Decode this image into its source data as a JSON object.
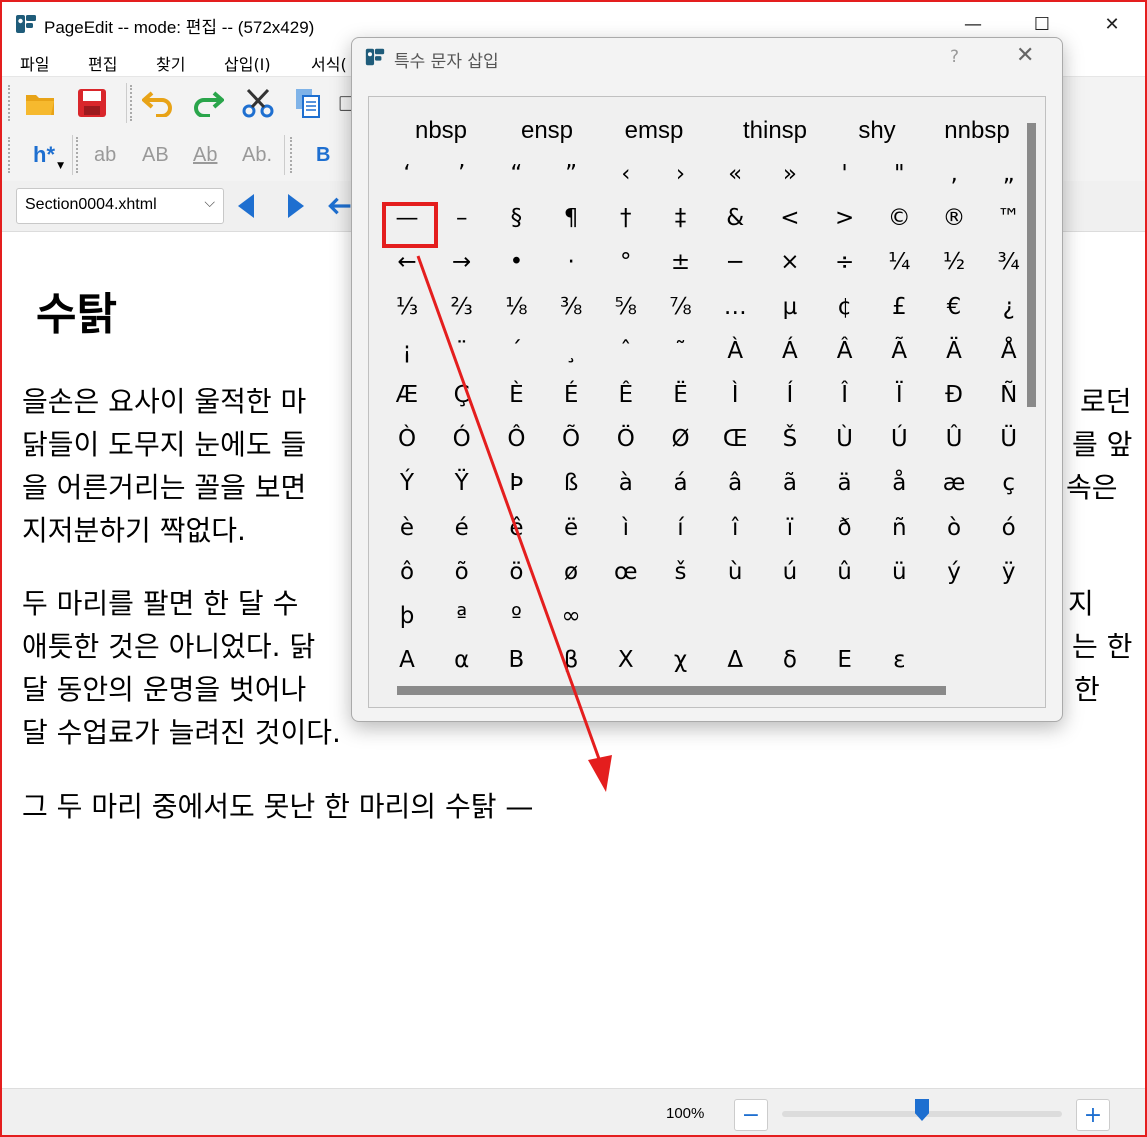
{
  "window": {
    "title": "PageEdit -- mode: 편집 -- (572x429)",
    "minimize": "—",
    "maximize": "☐",
    "close": "✕"
  },
  "menu": [
    "파일",
    "편집",
    "찾기",
    "삽입(I)",
    "서식("
  ],
  "toolbar": {
    "heading_button": "h*",
    "format_buttons": [
      "ab",
      "AB",
      "Ab",
      "Ab."
    ],
    "bold": "B",
    "file_select": "Section0004.xhtml"
  },
  "document": {
    "heading": "수탉",
    "paragraphs": [
      [
        "을손은 요사이 울적한 마",
        "로던",
        "닭들이 도무지 눈에도 들",
        "를 앞",
        "을 어른거리는 꼴을 보면",
        "속은",
        "지저분하기 짝없다."
      ],
      [
        "두 마리를 팔면 한 달 수",
        "지",
        "애틋한 것은 아니었다. 닭",
        "는 한",
        "달 동안의 운명을 벗어나",
        "한",
        "달 수업료가 늘려진 것이다."
      ],
      [
        "그 두 마리 중에서도 못난 한 마리의 수탉 —"
      ]
    ]
  },
  "status": {
    "zoom": "100%",
    "zoom_out": "−",
    "zoom_in": "+",
    "zoom_level": 0.5
  },
  "dialog": {
    "title": "특수 문자 삽입",
    "help": "?",
    "close": "✕",
    "named_row": [
      "nbsp",
      "ensp",
      "emsp",
      "thinsp",
      "shy",
      "nnbsp"
    ],
    "rows": [
      [
        "‘",
        "’",
        "“",
        "”",
        "‹",
        "›",
        "«",
        "»",
        "'",
        "\"",
        "‚",
        "„"
      ],
      [
        "—",
        "–",
        "§",
        "¶",
        "†",
        "‡",
        "&",
        "<",
        ">",
        "©",
        "®",
        "™"
      ],
      [
        "←",
        "→",
        "•",
        "·",
        "°",
        "±",
        "−",
        "×",
        "÷",
        "¼",
        "½",
        "¾"
      ],
      [
        "⅓",
        "⅔",
        "⅛",
        "⅜",
        "⅝",
        "⅞",
        "…",
        "µ",
        "¢",
        "£",
        "€",
        "¿"
      ],
      [
        "¡",
        "¨",
        "´",
        "¸",
        "ˆ",
        "˜",
        "À",
        "Á",
        "Â",
        "Ã",
        "Ä",
        "Å"
      ],
      [
        "Æ",
        "Ç",
        "È",
        "É",
        "Ê",
        "Ë",
        "Ì",
        "Í",
        "Î",
        "Ï",
        "Đ",
        "Ñ"
      ],
      [
        "Ò",
        "Ó",
        "Ô",
        "Õ",
        "Ö",
        "Ø",
        "Œ",
        "Š",
        "Ù",
        "Ú",
        "Û",
        "Ü"
      ],
      [
        "Ý",
        "Ÿ",
        "Þ",
        "ß",
        "à",
        "á",
        "â",
        "ã",
        "ä",
        "å",
        "æ",
        "ç"
      ],
      [
        "è",
        "é",
        "ê",
        "ë",
        "ì",
        "í",
        "î",
        "ï",
        "ð",
        "ñ",
        "ò",
        "ó"
      ],
      [
        "ô",
        "õ",
        "ö",
        "ø",
        "œ",
        "š",
        "ù",
        "ú",
        "û",
        "ü",
        "ý",
        "ÿ"
      ],
      [
        "þ",
        "ª",
        "º",
        "∞"
      ],
      [
        "Α",
        "α",
        "Β",
        "β",
        "Χ",
        "χ",
        "Δ",
        "δ",
        "Ε",
        "ε"
      ]
    ],
    "selected": "—"
  },
  "annotation_color": "#e41e1e",
  "accent_color": "#1e6fd0"
}
